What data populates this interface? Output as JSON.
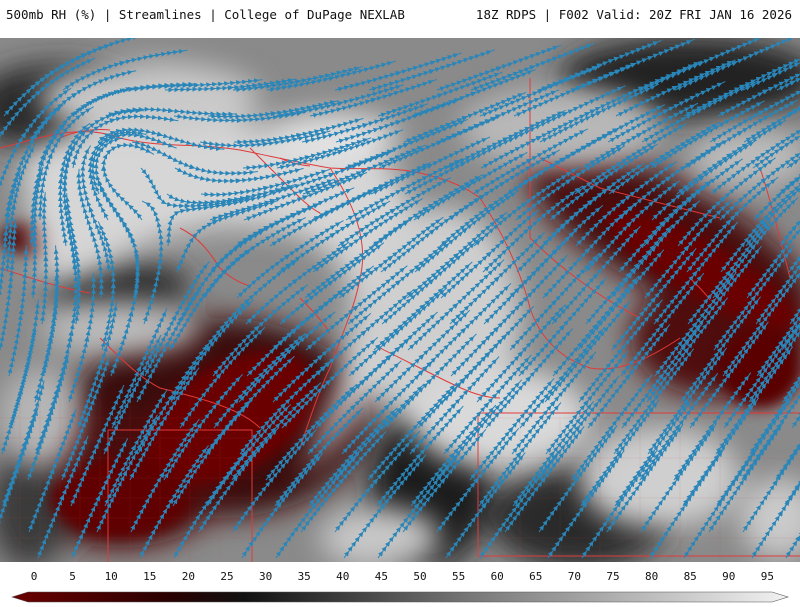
{
  "header": {
    "left_title": "500mb RH (%) | Streamlines | College of DuPage NEXLAB",
    "right_title": "18Z RDPS | F002 Valid: 20Z FRI JAN 16 2026"
  },
  "legend": {
    "labels": [
      "0",
      "5",
      "10",
      "15",
      "20",
      "25",
      "30",
      "35",
      "40",
      "45",
      "50",
      "55",
      "60",
      "65",
      "70",
      "75",
      "80",
      "85",
      "90",
      "95"
    ],
    "low_color": "#6b0000",
    "mid_color": "#1a1a1a",
    "high_color": "#f2f2f2"
  },
  "map": {
    "streamline_color": "#2a86b8",
    "border_color": "#e03a3a"
  }
}
